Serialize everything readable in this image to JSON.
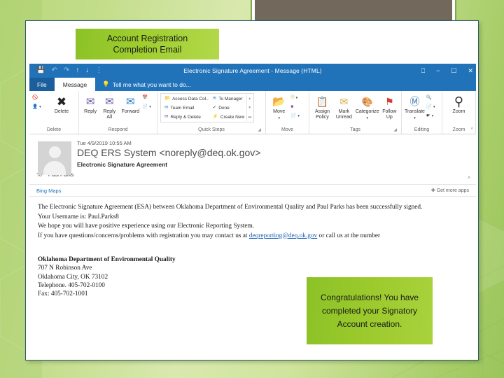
{
  "slide": {
    "title_callout": {
      "line1": "Account Registration",
      "line2": "Completion Email"
    },
    "congrats_callout": "Congratulations! You have completed your Signatory Account creation.",
    "accent_green": "#8cc227",
    "olive_box_color": "#72695c",
    "panel_border_color": "#2b5c68"
  },
  "outlook": {
    "titlebar": {
      "title": "Electronic Signature Agreement - Message (HTML)",
      "accent_color": "#2072b9",
      "quick_access": [
        "save-icon",
        "undo-icon",
        "redo-icon",
        "up-icon",
        "down-icon",
        "more-icon"
      ],
      "window_controls": [
        "ribbon-display-options-icon",
        "minimize-icon",
        "maximize-icon",
        "close-icon"
      ]
    },
    "tabs": {
      "file": "File",
      "message": "Message",
      "tell_me": "Tell me what you want to do..."
    },
    "ribbon": {
      "groups": [
        {
          "label": "Delete",
          "big_buttons": [
            {
              "label": "Delete",
              "icon": "delete-x-icon"
            }
          ],
          "small_buttons": [
            {
              "label": "",
              "icon": "ignore-icon"
            },
            {
              "label": "",
              "icon": "junk-icon"
            }
          ]
        },
        {
          "label": "Respond",
          "big_buttons": [
            {
              "label": "Reply",
              "icon": "reply-icon"
            },
            {
              "label": "Reply All",
              "icon": "reply-all-icon"
            },
            {
              "label": "Forward",
              "icon": "forward-icon"
            }
          ],
          "small_buttons": [
            {
              "label": "",
              "icon": "meeting-icon"
            },
            {
              "label": "",
              "icon": "more-respond-icon"
            }
          ]
        },
        {
          "label": "Quick Steps",
          "dialog_launcher": true,
          "items_col1": [
            {
              "label": "Access Data Col..",
              "icon": "folder-move-icon"
            },
            {
              "label": "Team Email",
              "icon": "team-email-icon"
            },
            {
              "label": "Reply & Delete",
              "icon": "reply-delete-icon"
            }
          ],
          "items_col2": [
            {
              "label": "To Manager",
              "icon": "to-manager-icon"
            },
            {
              "label": "Done",
              "icon": "done-check-icon"
            },
            {
              "label": "Create New",
              "icon": "create-new-icon"
            }
          ]
        },
        {
          "label": "Move",
          "big_buttons": [
            {
              "label": "Move",
              "icon": "move-folder-icon"
            }
          ],
          "small_buttons": [
            {
              "label": "",
              "icon": "rules-icon"
            },
            {
              "label": "",
              "icon": "onenote-icon"
            },
            {
              "label": "",
              "icon": "actions-icon"
            }
          ]
        },
        {
          "label": "Tags",
          "dialog_launcher": true,
          "big_buttons": [
            {
              "label": "Assign Policy",
              "icon": "assign-policy-icon"
            },
            {
              "label": "Mark Unread",
              "icon": "mark-unread-icon"
            },
            {
              "label": "Categorize",
              "icon": "categorize-icon"
            },
            {
              "label": "Follow Up",
              "icon": "follow-up-flag-icon"
            }
          ]
        },
        {
          "label": "Editing",
          "big_buttons": [
            {
              "label": "Translate",
              "icon": "translate-icon"
            }
          ],
          "small_buttons": [
            {
              "label": "",
              "icon": "find-icon"
            },
            {
              "label": "",
              "icon": "related-icon"
            },
            {
              "label": "",
              "icon": "select-icon"
            }
          ]
        },
        {
          "label": "Zoom",
          "big_buttons": [
            {
              "label": "Zoom",
              "icon": "zoom-magnifier-icon"
            }
          ]
        }
      ],
      "collapse_icon": "chevron-up-icon"
    },
    "message_header": {
      "date": "Tue 4/9/2019 10:55 AM",
      "from": "DEQ ERS System <noreply@deq.ok.gov>",
      "subject": "Electronic Signature Agreement",
      "to_label": "To",
      "to_value": "Paul Parks",
      "expand_icon": "chevron-up-icon"
    },
    "addins_bar": {
      "app": "Bing Maps",
      "get_more": "Get more apps",
      "plus_icon": "plus-icon"
    },
    "message_body": {
      "paragraphs": [
        "The Electronic Signature Agreement (ESA) between Oklahoma Department of Environmental Quality and Paul Parks has been successfully signed.",
        "Your Username is: Paul.Parks8",
        "We hope you will have positive experience using our Electronic Reporting System."
      ],
      "contact_line_prefix": "If you have questions/concerns/problems with registration you may contact us at ",
      "contact_email": "deqreporting@deq.ok.gov",
      "contact_line_suffix": " or call us at the number",
      "signature": {
        "org": "Oklahoma Department of Environmental Quality",
        "street": "707 N Robinson Ave",
        "city": "Oklahoma City, OK 73102",
        "telephone": "Telephone. 405-702-0100",
        "fax": "Fax: 405-702-1001"
      }
    }
  }
}
